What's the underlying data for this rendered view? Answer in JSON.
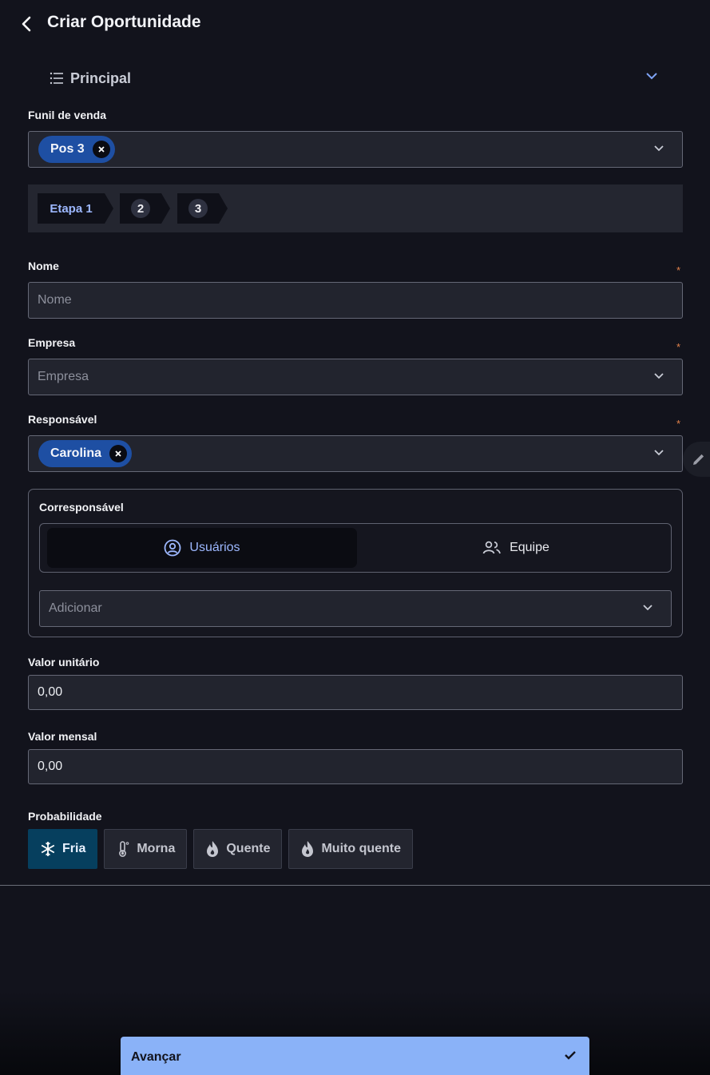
{
  "header": {
    "title": "Criar Oportunidade"
  },
  "section": {
    "title": "Principal"
  },
  "funnel": {
    "label": "Funil de venda",
    "chip": "Pos 3"
  },
  "stepper": {
    "steps": [
      "Etapa 1",
      "2",
      "3"
    ]
  },
  "nome": {
    "label": "Nome",
    "required_mark": "*",
    "placeholder": "Nome",
    "value": ""
  },
  "empresa": {
    "label": "Empresa",
    "required_mark": "*",
    "placeholder": "Empresa"
  },
  "responsavel": {
    "label": "Responsável",
    "required_mark": "*",
    "chip": "Carolina"
  },
  "corresponsavel": {
    "label": "Corresponsável",
    "tabs": [
      {
        "label": "Usuários",
        "icon": "user-circle-icon",
        "active": true
      },
      {
        "label": "Equipe",
        "icon": "group-icon",
        "active": false
      }
    ],
    "add_placeholder": "Adicionar"
  },
  "valor_unitario": {
    "label": "Valor unitário",
    "value": "0,00"
  },
  "valor_mensal": {
    "label": "Valor mensal",
    "value": "0,00"
  },
  "probabilidade": {
    "label": "Probabilidade",
    "options": [
      {
        "label": "Fria",
        "icon": "snowflake-icon",
        "active": true
      },
      {
        "label": "Morna",
        "icon": "thermometer-icon",
        "active": false
      },
      {
        "label": "Quente",
        "icon": "flame-icon",
        "active": false
      },
      {
        "label": "Muito quente",
        "icon": "fire-icon",
        "active": false
      }
    ]
  },
  "footer": {
    "advance_label": "Avançar"
  },
  "colors": {
    "accent": "#8ab2f8",
    "chip": "#1e4fa3",
    "active_prob": "#063f5e",
    "background": "#12131c"
  }
}
